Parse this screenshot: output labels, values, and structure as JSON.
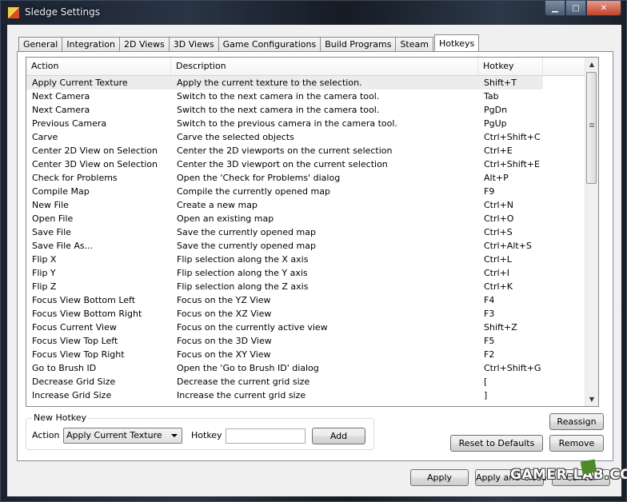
{
  "window": {
    "title": "Sledge Settings"
  },
  "tabs": [
    "General",
    "Integration",
    "2D Views",
    "3D Views",
    "Game Configurations",
    "Build Programs",
    "Steam",
    "Hotkeys"
  ],
  "active_tab": "Hotkeys",
  "hotkeys": {
    "columns": [
      "Action",
      "Description",
      "Hotkey"
    ],
    "selected_row": 0,
    "rows": [
      [
        "Apply Current Texture",
        "Apply the current texture to the selection.",
        "Shift+T"
      ],
      [
        "Next Camera",
        "Switch to the next camera in the camera tool.",
        "Tab"
      ],
      [
        "Next Camera",
        "Switch to the next camera in the camera tool.",
        "PgDn"
      ],
      [
        "Previous Camera",
        "Switch to the previous camera in the camera tool.",
        "PgUp"
      ],
      [
        "Carve",
        "Carve the selected objects",
        "Ctrl+Shift+C"
      ],
      [
        "Center 2D View on Selection",
        "Center the 2D viewports on the current selection",
        "Ctrl+E"
      ],
      [
        "Center 3D View on Selection",
        "Center the 3D viewport on the current selection",
        "Ctrl+Shift+E"
      ],
      [
        "Check for Problems",
        "Open the 'Check for Problems' dialog",
        "Alt+P"
      ],
      [
        "Compile Map",
        "Compile the currently opened map",
        "F9"
      ],
      [
        "New File",
        "Create a new map",
        "Ctrl+N"
      ],
      [
        "Open File",
        "Open an existing map",
        "Ctrl+O"
      ],
      [
        "Save File",
        "Save the currently opened map",
        "Ctrl+S"
      ],
      [
        "Save File As...",
        "Save the currently opened map",
        "Ctrl+Alt+S"
      ],
      [
        "Flip X",
        "Flip selection along the X axis",
        "Ctrl+L"
      ],
      [
        "Flip Y",
        "Flip selection along the Y axis",
        "Ctrl+I"
      ],
      [
        "Flip Z",
        "Flip selection along the Z axis",
        "Ctrl+K"
      ],
      [
        "Focus View Bottom Left",
        "Focus on the YZ View",
        "F4"
      ],
      [
        "Focus View Bottom Right",
        "Focus on the XZ View",
        "F3"
      ],
      [
        "Focus Current View",
        "Focus on the currently active view",
        "Shift+Z"
      ],
      [
        "Focus View Top Left",
        "Focus on the 3D View",
        "F5"
      ],
      [
        "Focus View Top Right",
        "Focus on the XY View",
        "F2"
      ],
      [
        "Go to Brush ID",
        "Open the 'Go to Brush ID' dialog",
        "Ctrl+Shift+G"
      ],
      [
        "Decrease Grid Size",
        "Decrease the current grid size",
        "["
      ],
      [
        "Increase Grid Size",
        "Increase the current grid size",
        "]"
      ]
    ]
  },
  "new_hotkey": {
    "group_label": "New Hotkey",
    "action_label": "Action",
    "action_value": "Apply Current Texture",
    "hotkey_label": "Hotkey",
    "hotkey_value": "",
    "add_label": "Add"
  },
  "buttons": {
    "reassign": "Reassign",
    "reset": "Reset to Defaults",
    "remove": "Remove",
    "apply": "Apply",
    "apply_close": "Apply and Close",
    "cancel": "Cancel"
  },
  "watermark": "GAMER-LAB.COM",
  "icons": {
    "minimize": "minimize-icon",
    "maximize": "maximize-icon",
    "close": "close-icon",
    "scroll_up": "scroll-up-icon",
    "scroll_down": "scroll-down-icon",
    "dropdown": "chevron-down-icon"
  }
}
